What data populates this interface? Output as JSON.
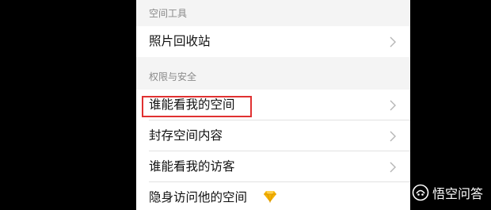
{
  "sections": [
    {
      "header": "空间工具",
      "items": [
        {
          "label": "照片回收站",
          "chevron_icon": "chevron-right-icon"
        }
      ]
    },
    {
      "header": "权限与安全",
      "items": [
        {
          "label": "谁能看我的空间",
          "chevron_icon": "chevron-right-icon",
          "highlighted": true
        },
        {
          "label": "封存空间内容",
          "chevron_icon": "chevron-right-icon"
        },
        {
          "label": "谁能看我的访客",
          "chevron_icon": "chevron-right-icon"
        },
        {
          "label": "隐身访问他的空间",
          "badge_icon": "diamond-vip-icon"
        }
      ]
    }
  ],
  "watermark": {
    "text": "悟空问答",
    "logo_icon": "wukong-logo-icon"
  },
  "colors": {
    "background": "#000000",
    "panel": "#f4f4f4",
    "row": "#ffffff",
    "highlight_border": "#e03131",
    "diamond": "#f5b301",
    "section_header_text": "#8a8a8a"
  }
}
